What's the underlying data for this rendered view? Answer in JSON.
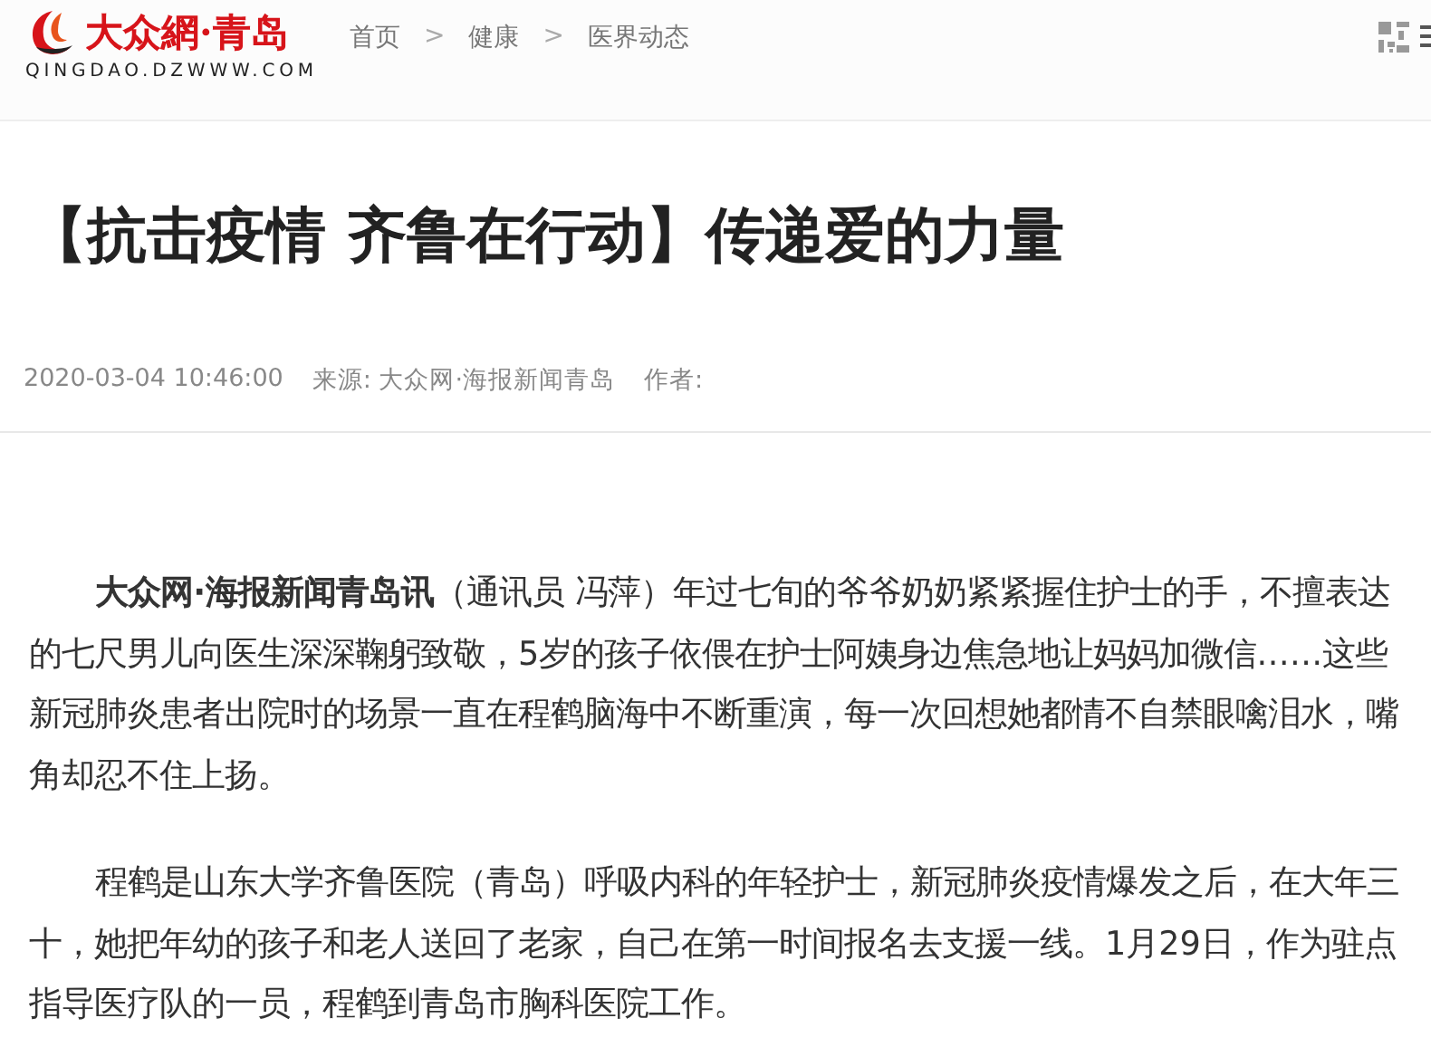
{
  "header": {
    "logo": {
      "name": "大众網·青岛",
      "domain": "QINGDAO.DZWWW.COM"
    },
    "breadcrumb": [
      "首页",
      "健康",
      "医界动态"
    ],
    "separator": ">"
  },
  "article": {
    "title": "【抗击疫情 齐鲁在行动】传递爱的力量",
    "meta": {
      "date": "2020-03-04 10:46:00",
      "source": "来源: 大众网·海报新闻青岛",
      "author": "作者:"
    },
    "paragraphs": [
      "**大众网·海报新闻青岛讯**（通讯员 冯萍）年过七旬的爷爷奶奶紧紧握住护士的手，不擅表达的七尺男儿向医生深深鞠躬致敬，5岁的孩子依偎在护士阿姨身边焦急地让妈妈加微信……这些新冠肺炎患者出院时的场景一直在程鹤脑海中不断重演，每一次回想她都情不自禁眼噙泪水，嘴角却忍不住上扬。",
      "程鹤是山东大学齐鲁医院（青岛）呼吸内科的年轻护士，新冠肺炎疫情爆发之后，在大年三十，她把年幼的孩子和老人送回了老家，自己在第一时间报名去支援一线。1月29日，作为驻点指导医疗队的一员，程鹤到青岛市胸科医院工作。"
    ]
  }
}
